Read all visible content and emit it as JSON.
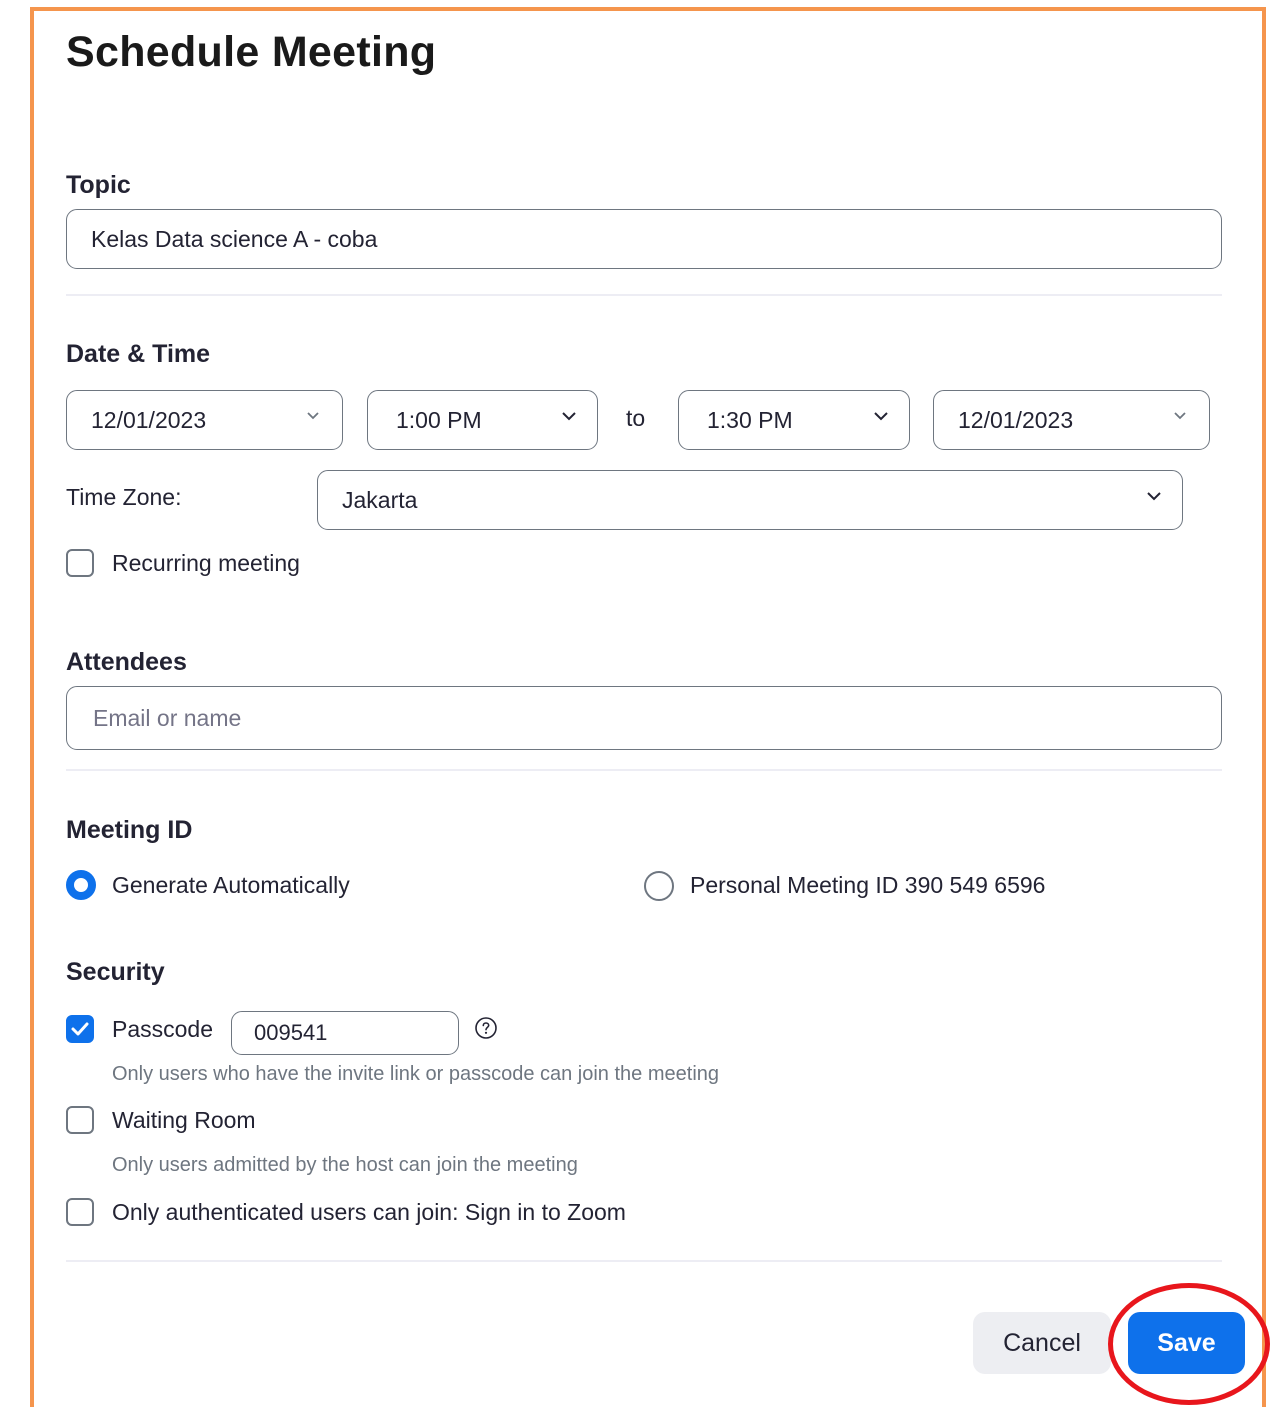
{
  "title": "Schedule Meeting",
  "topic": {
    "label": "Topic",
    "value": "Kelas Data science A - coba"
  },
  "date_time": {
    "label": "Date & Time",
    "start_date": "12/01/2023",
    "start_time": "1:00 PM",
    "to_label": "to",
    "end_time": "1:30 PM",
    "end_date": "12/01/2023",
    "timezone_label": "Time Zone:",
    "timezone_value": "Jakarta",
    "recurring_label": "Recurring meeting",
    "recurring_checked": false
  },
  "attendees": {
    "label": "Attendees",
    "placeholder": "Email or name"
  },
  "meeting_id": {
    "label": "Meeting ID",
    "option_auto": "Generate Automatically",
    "option_personal": "Personal Meeting ID 390 549 6596",
    "selected": "auto"
  },
  "security": {
    "label": "Security",
    "passcode_label": "Passcode",
    "passcode_value": "009541",
    "passcode_checked": true,
    "passcode_hint": "Only users who have the invite link or passcode can join the meeting",
    "waiting_room_label": "Waiting Room",
    "waiting_room_checked": false,
    "waiting_room_hint": "Only users admitted by the host can join the meeting",
    "auth_label": "Only authenticated users can join: Sign in to Zoom",
    "auth_checked": false
  },
  "buttons": {
    "cancel": "Cancel",
    "save": "Save"
  },
  "colors": {
    "accent": "#0e71eb",
    "frame": "#f5954d",
    "highlight": "#e8161c"
  }
}
